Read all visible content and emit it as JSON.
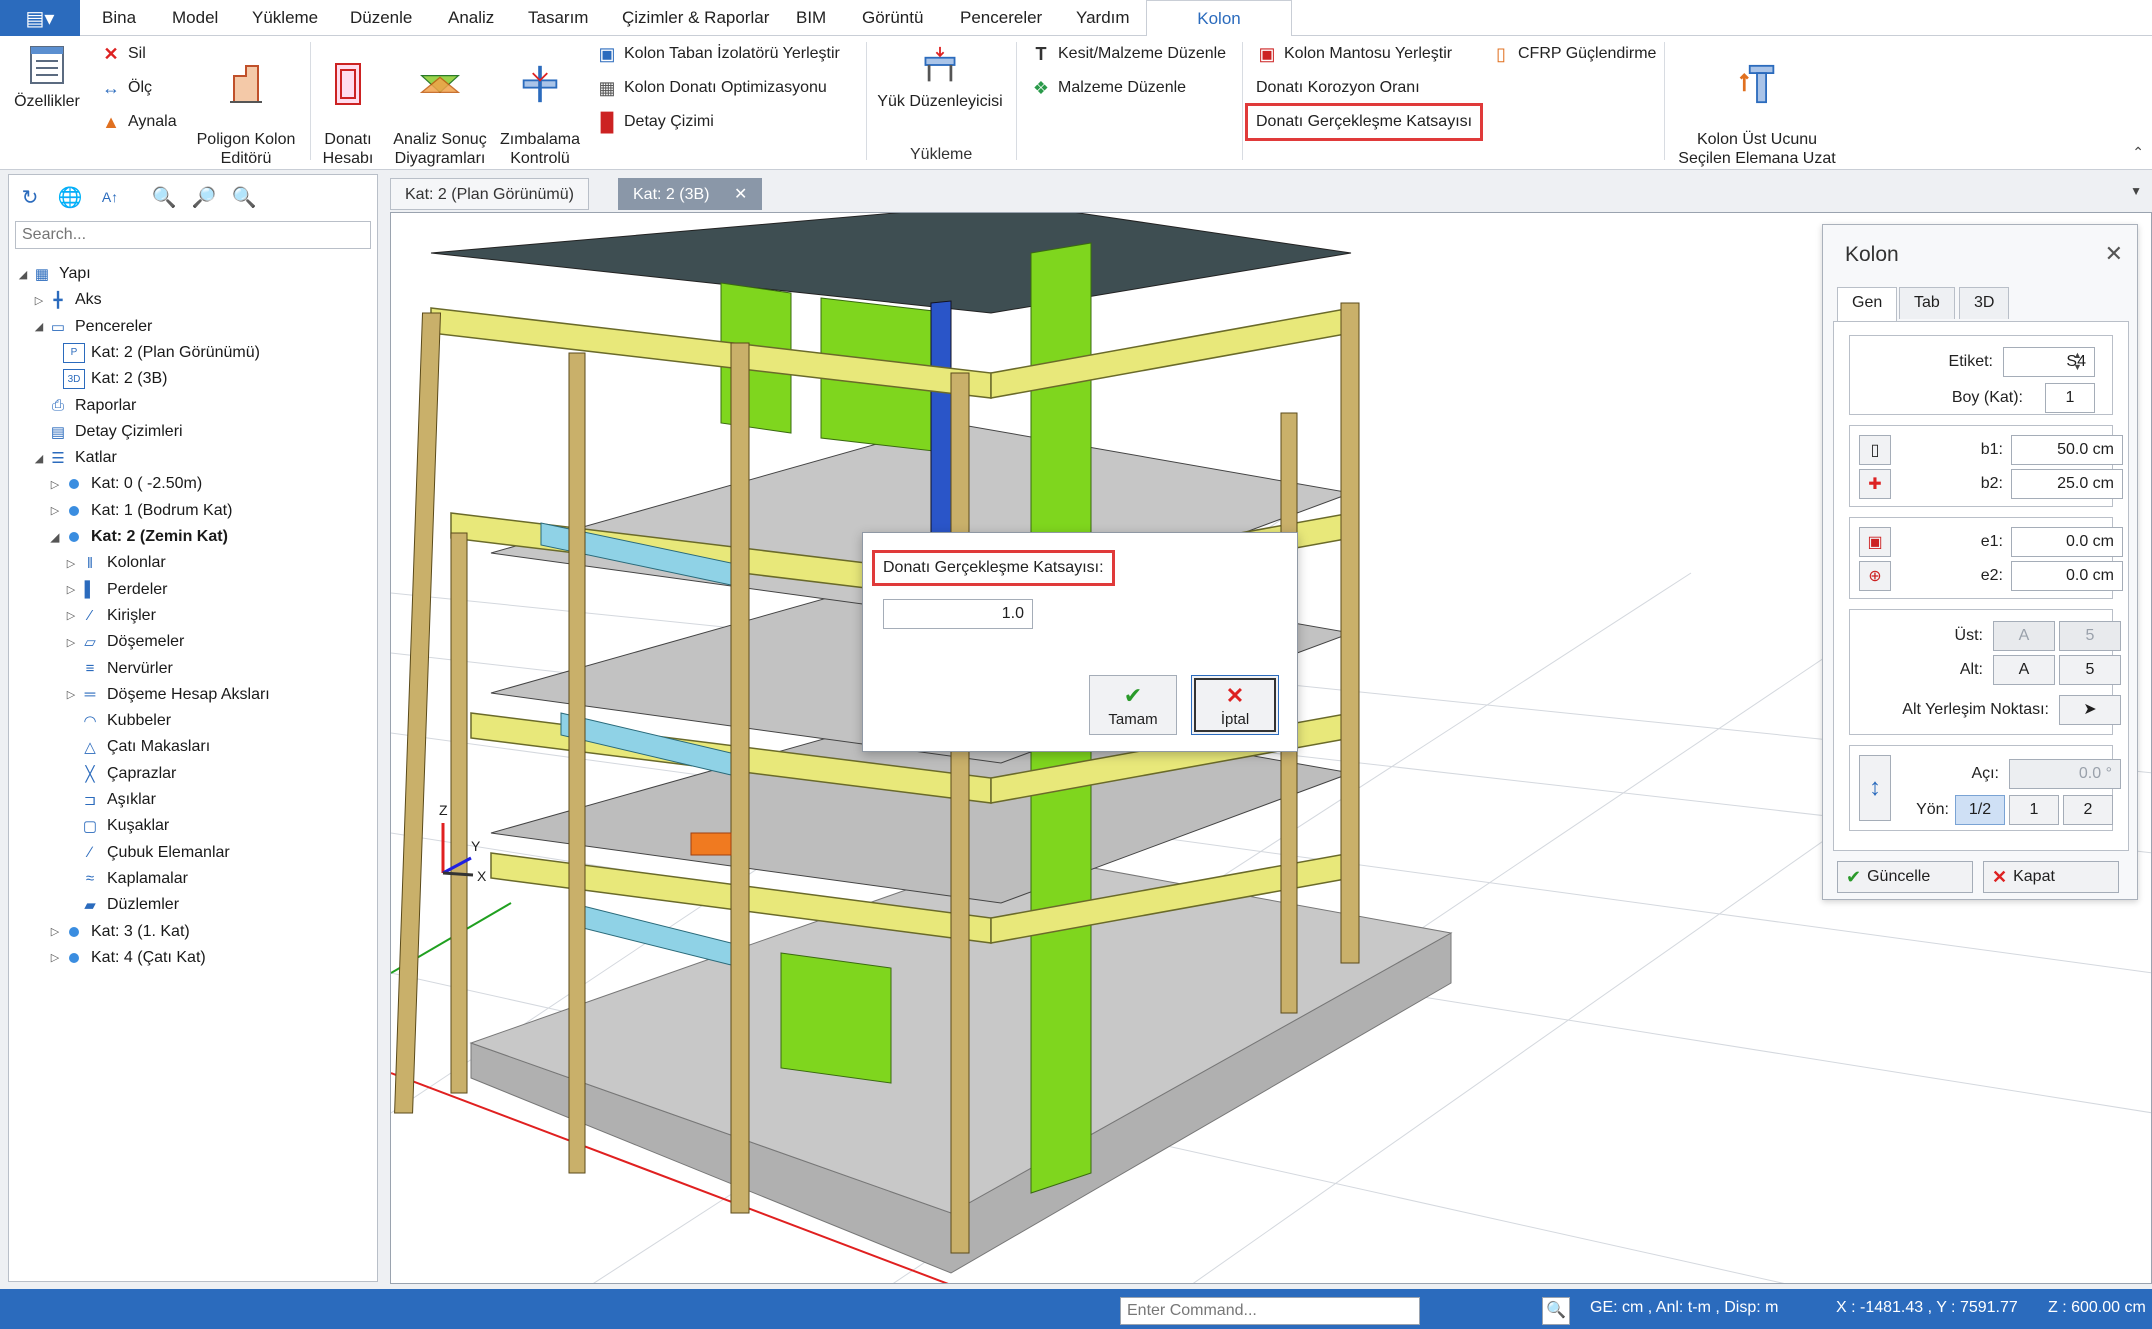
{
  "ribbon": {
    "tabs": [
      "Bina",
      "Model",
      "Yükleme",
      "Düzenle",
      "Analiz",
      "Tasarım",
      "Çizimler & Raporlar",
      "BIM",
      "Görüntü",
      "Pencereler",
      "Yardım",
      "Kolon"
    ],
    "active_tab": "Kolon",
    "buttons": {
      "ozellikler": "Özellikler",
      "sil": "Sil",
      "olc": "Ölç",
      "aynala": "Aynala",
      "poligon_kolon_editoru": "Poligon Kolon\nEditörü",
      "donati_hesabi": "Donatı\nHesabı",
      "analiz_sonuc": "Analiz Sonuç\nDiyagramları",
      "zimbalama": "Zımbalama\nKontrolü",
      "kolon_taban": "Kolon Taban İzolatörü Yerleştir",
      "kolon_donati_opt": "Kolon Donatı Optimizasyonu",
      "detay_cizimi": "Detay Çizimi",
      "yuk_duzenleyicisi": "Yük Düzenleyicisi",
      "kesit_malzeme": "Kesit/Malzeme Düzenle",
      "malzeme_duzenle": "Malzeme Düzenle",
      "kolon_mantosu": "Kolon Mantosu Yerleştir",
      "cfrp": "CFRP Güçlendirme",
      "donati_korozyon": "Donatı Korozyon Oranı",
      "donati_gerceklesme": "Donatı Gerçekleşme Katsayısı",
      "kolon_ust_ucunu": "Kolon Üst Ucunu\nSeçilen Elemana Uzat"
    },
    "group_label_yukleme": "Yükleme"
  },
  "left_panel": {
    "search_placeholder": "Search...",
    "tree": [
      {
        "label": "Yapı",
        "level": 0,
        "expanded": true,
        "icon": "building-grid-icon"
      },
      {
        "label": "Aks",
        "level": 1,
        "expanded": false,
        "icon": "axis-grid-icon"
      },
      {
        "label": "Pencereler",
        "level": 1,
        "expanded": true,
        "icon": "windows-icon"
      },
      {
        "label": "Kat: 2 (Plan Görünümü)",
        "level": 2,
        "icon": "plan-view-icon"
      },
      {
        "label": "Kat: 2 (3B)",
        "level": 2,
        "icon": "3d-view-icon"
      },
      {
        "label": "Raporlar",
        "level": 1,
        "icon": "printer-icon"
      },
      {
        "label": "Detay Çizimleri",
        "level": 1,
        "icon": "detail-drawing-icon"
      },
      {
        "label": "Katlar",
        "level": 1,
        "expanded": true,
        "icon": "floors-icon"
      },
      {
        "label": "Kat: 0 ( -2.50m)",
        "level": 2,
        "expanded": false,
        "icon": "floor-dot-icon"
      },
      {
        "label": "Kat: 1 (Bodrum Kat)",
        "level": 2,
        "expanded": false,
        "icon": "floor-dot-icon"
      },
      {
        "label": "Kat: 2 (Zemin Kat)",
        "level": 2,
        "expanded": true,
        "bold": true,
        "icon": "floor-dot-icon"
      },
      {
        "label": "Kolonlar",
        "level": 3,
        "expanded": false,
        "icon": "column-icon"
      },
      {
        "label": "Perdeler",
        "level": 3,
        "expanded": false,
        "icon": "shear-wall-icon"
      },
      {
        "label": "Kirişler",
        "level": 3,
        "expanded": false,
        "icon": "beam-icon"
      },
      {
        "label": "Döşemeler",
        "level": 3,
        "expanded": false,
        "icon": "slab-icon"
      },
      {
        "label": "Nervürler",
        "level": 3,
        "icon": "rib-icon"
      },
      {
        "label": "Döşeme Hesap Aksları",
        "level": 3,
        "expanded": false,
        "icon": "slab-axis-icon"
      },
      {
        "label": "Kubbeler",
        "level": 3,
        "icon": "dome-icon"
      },
      {
        "label": "Çatı Makasları",
        "level": 3,
        "icon": "roof-truss-icon"
      },
      {
        "label": "Çaprazlar",
        "level": 3,
        "icon": "brace-icon"
      },
      {
        "label": "Aşıklar",
        "level": 3,
        "icon": "purlin-icon"
      },
      {
        "label": "Kuşaklar",
        "level": 3,
        "icon": "girt-icon"
      },
      {
        "label": "Çubuk Elemanlar",
        "level": 3,
        "icon": "bar-element-icon"
      },
      {
        "label": "Kaplamalar",
        "level": 3,
        "icon": "cladding-icon"
      },
      {
        "label": "Düzlemler",
        "level": 3,
        "icon": "plane-icon"
      },
      {
        "label": "Kat: 3 (1. Kat)",
        "level": 2,
        "expanded": false,
        "icon": "floor-dot-icon"
      },
      {
        "label": "Kat: 4 (Çatı Kat)",
        "level": 2,
        "expanded": false,
        "icon": "floor-dot-icon"
      }
    ]
  },
  "doc_tabs": [
    {
      "label": "Kat: 2 (Plan Görünümü)",
      "active": false
    },
    {
      "label": "Kat: 2 (3B)",
      "active": true
    }
  ],
  "viewport": {
    "axis_labels": {
      "z": "Z",
      "y": "Y",
      "x": "X"
    }
  },
  "dialog": {
    "label": "Donatı Gerçekleşme Katsayısı:",
    "value": "1.0",
    "ok_label": "Tamam",
    "cancel_label": "İptal"
  },
  "prop_panel": {
    "title": "Kolon",
    "tabs": [
      "Gen",
      "Tab",
      "3D"
    ],
    "etiket_label": "Etiket:",
    "etiket_value": "S4",
    "boy_label": "Boy (Kat):",
    "boy_value": "1",
    "b1_label": "b1:",
    "b1_value": "50.0 cm",
    "b2_label": "b2:",
    "b2_value": "25.0 cm",
    "e1_label": "e1:",
    "e1_value": "0.0 cm",
    "e2_label": "e2:",
    "e2_value": "0.0 cm",
    "ust_label": "Üst:",
    "ust_a": "A",
    "ust_5": "5",
    "alt_label": "Alt:",
    "alt_a": "A",
    "alt_5": "5",
    "alt_yerlesim_label": "Alt Yerleşim Noktası:",
    "aci_label": "Açı:",
    "aci_value": "0.0 °",
    "yon_label": "Yön:",
    "yon_options": [
      "1/2",
      "1",
      "2"
    ],
    "yon_selected": "1/2",
    "update_label": "Güncelle",
    "close_label": "Kapat"
  },
  "status_bar": {
    "command_placeholder": "Enter Command...",
    "units": "GE: cm , Anl: t-m , Disp: m",
    "coords": "X : -1481.43 , Y : 7591.77",
    "z": "Z : 600.00 cm"
  },
  "colors": {
    "accent": "#2b6bbd",
    "highlight_red": "#e03a3a",
    "wall_green": "#7fd61e",
    "beam_yellow": "#e8e87a",
    "column_tan": "#c9b06a"
  }
}
